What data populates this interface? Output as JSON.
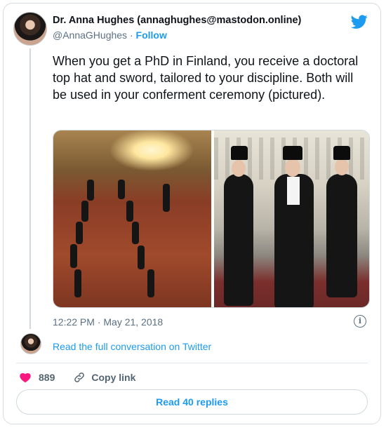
{
  "author": {
    "display_name": "Dr. Anna Hughes (annaghughes@mastodon.online)",
    "handle": "@AnnaGHughes",
    "separator": "·",
    "follow_label": "Follow"
  },
  "tweet": {
    "text": "When you get a PhD in Finland, you receive a doctoral top hat and sword, tailored to your discipline.  Both will be used in your conferment ceremony (pictured).",
    "timestamp": "12:22 PM · May 21, 2018"
  },
  "conversation": {
    "link_label": "Read the full conversation on Twitter"
  },
  "actions": {
    "like_count": "889",
    "copy_link_label": "Copy link",
    "replies_label": "Read 40 replies"
  },
  "icons": {
    "brand": "twitter-bird-icon",
    "info": "info-icon",
    "like": "heart-icon",
    "copy": "link-icon"
  },
  "colors": {
    "accent": "#1d9bf0",
    "heart": "#f91880",
    "muted": "#5b7083"
  }
}
